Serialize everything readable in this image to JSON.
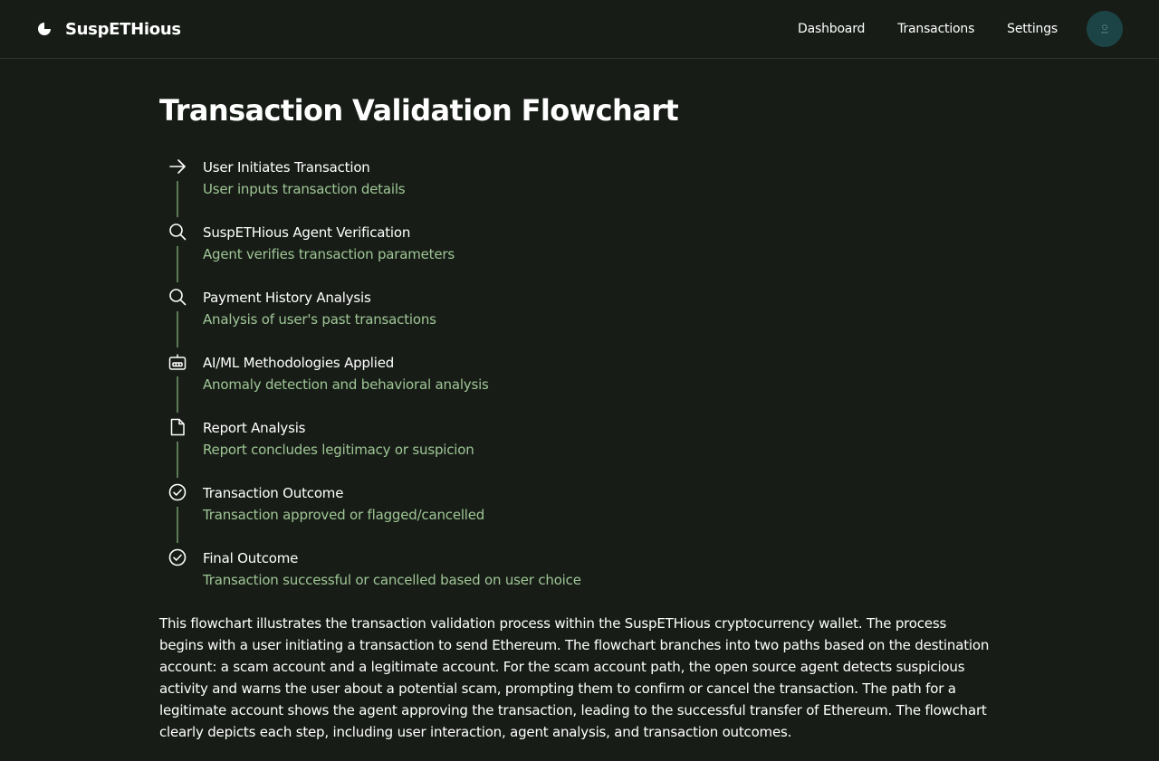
{
  "app": {
    "name": "SuspETHious"
  },
  "nav": {
    "items": [
      {
        "label": "Dashboard"
      },
      {
        "label": "Transactions"
      },
      {
        "label": "Settings"
      }
    ]
  },
  "page": {
    "title": "Transaction Validation Flowchart",
    "steps": [
      {
        "icon": "arrow-right-icon",
        "title": "User Initiates Transaction",
        "desc": "User inputs transaction details"
      },
      {
        "icon": "search-icon",
        "title": "SuspETHious Agent Verification",
        "desc": "Agent verifies transaction parameters"
      },
      {
        "icon": "search-icon",
        "title": "Payment History Analysis",
        "desc": "Analysis of user's past transactions"
      },
      {
        "icon": "robot-icon",
        "title": "AI/ML Methodologies Applied",
        "desc": "Anomaly detection and behavioral analysis"
      },
      {
        "icon": "document-icon",
        "title": "Report Analysis",
        "desc": "Report concludes legitimacy or suspicion"
      },
      {
        "icon": "check-circle-icon",
        "title": "Transaction Outcome",
        "desc": "Transaction approved or flagged/cancelled"
      },
      {
        "icon": "check-circle-icon",
        "title": "Final Outcome",
        "desc": "Transaction successful or cancelled based on user choice"
      }
    ],
    "description": "This flowchart illustrates the transaction validation process within the SuspETHious cryptocurrency wallet. The process begins with a user initiating a transaction to send Ethereum. The flowchart branches into two paths based on the destination account: a scam account and a legitimate account. For the scam account path, the open source agent detects suspicious activity and warns the user about a potential scam, prompting them to confirm or cancel the transaction. The path for a legitimate account shows the agent approving the transaction, leading to the successful transfer of Ethereum. The flowchart clearly depicts each step, including user interaction, agent analysis, and transaction outcomes."
  },
  "colors": {
    "background": "#171d16",
    "accent_text": "#9fc596",
    "connector": "#5b7a55",
    "avatar": "#1c4447"
  }
}
